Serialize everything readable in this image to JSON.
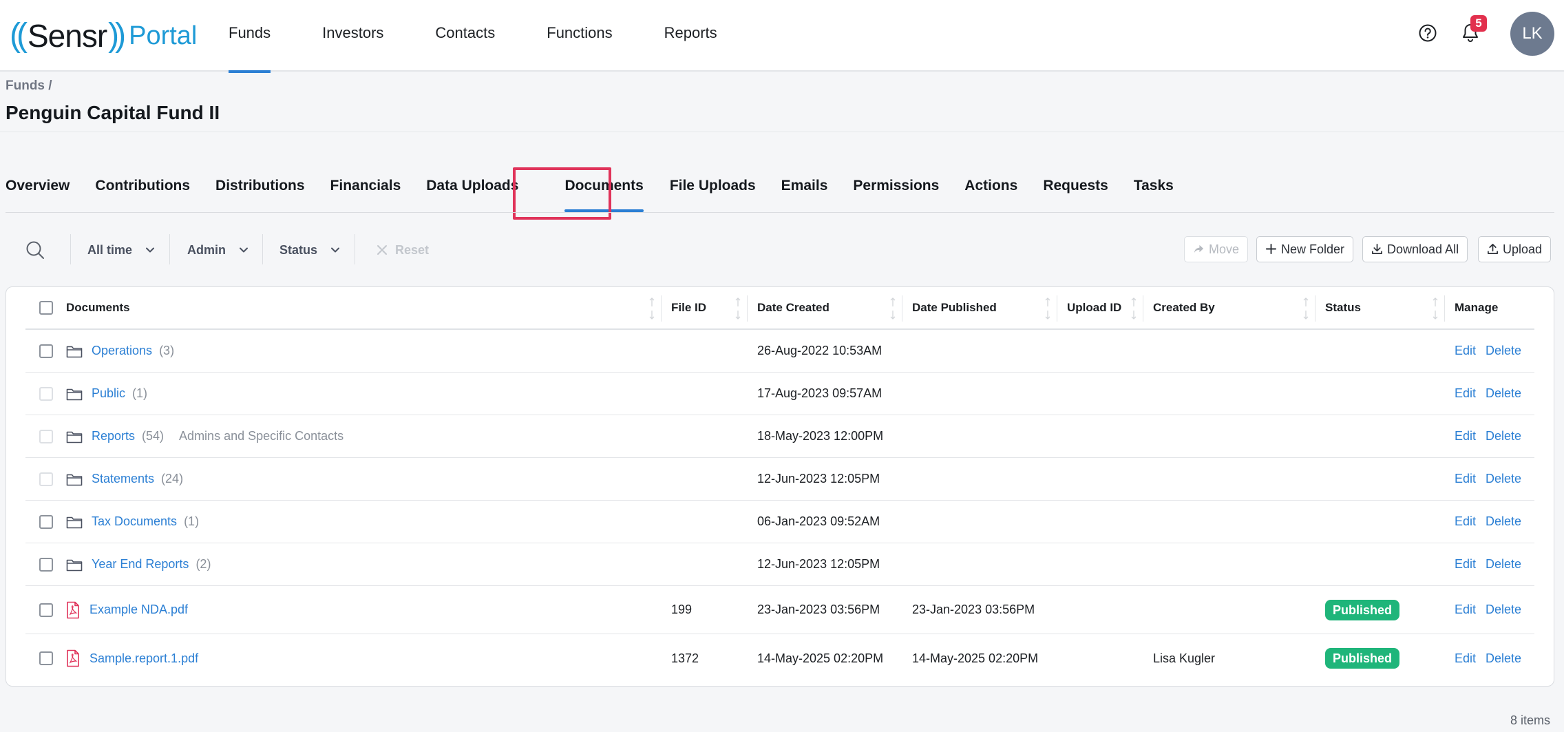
{
  "app": {
    "logo_paren_open": "((",
    "logo_sensr": "Sensr",
    "logo_paren_close": "))",
    "logo_portal": "Portal"
  },
  "nav": {
    "items": [
      {
        "label": "Funds",
        "active": true
      },
      {
        "label": "Investors"
      },
      {
        "label": "Contacts"
      },
      {
        "label": "Functions"
      },
      {
        "label": "Reports"
      }
    ],
    "notification_count": "5",
    "avatar_initials": "LK"
  },
  "breadcrumb": "Funds /",
  "page_title": "Penguin Capital Fund II",
  "tabs": [
    {
      "label": "Overview"
    },
    {
      "label": "Contributions"
    },
    {
      "label": "Distributions"
    },
    {
      "label": "Financials"
    },
    {
      "label": "Data Uploads"
    },
    {
      "label": "Documents",
      "active": true
    },
    {
      "label": "File Uploads"
    },
    {
      "label": "Emails"
    },
    {
      "label": "Permissions"
    },
    {
      "label": "Actions"
    },
    {
      "label": "Requests"
    },
    {
      "label": "Tasks"
    }
  ],
  "toolbar": {
    "filter_time": "All time",
    "filter_role": "Admin",
    "filter_status": "Status",
    "reset": "Reset",
    "move": "Move",
    "new_folder": "New Folder",
    "download_all": "Download All",
    "upload": "Upload"
  },
  "table": {
    "columns": {
      "documents": "Documents",
      "file_id": "File ID",
      "date_created": "Date Created",
      "date_published": "Date Published",
      "upload_id": "Upload ID",
      "created_by": "Created By",
      "status": "Status",
      "manage": "Manage"
    },
    "rows": [
      {
        "type": "folder",
        "name": "Operations",
        "count": "(3)",
        "access": "",
        "file_id": "",
        "date_created": "26-Aug-2022 10:53AM",
        "date_published": "",
        "upload_id": "",
        "created_by": "",
        "status": "",
        "edit": "Edit",
        "delete": "Delete"
      },
      {
        "type": "folder",
        "name": "Public",
        "count": "(1)",
        "access": "",
        "file_id": "",
        "date_created": "17-Aug-2023 09:57AM",
        "date_published": "",
        "upload_id": "",
        "created_by": "",
        "status": "",
        "edit": "Edit",
        "delete": "Delete"
      },
      {
        "type": "folder",
        "name": "Reports",
        "count": "(54)",
        "access": "Admins and Specific Contacts",
        "file_id": "",
        "date_created": "18-May-2023 12:00PM",
        "date_published": "",
        "upload_id": "",
        "created_by": "",
        "status": "",
        "edit": "Edit",
        "delete": "Delete"
      },
      {
        "type": "folder",
        "name": "Statements",
        "count": "(24)",
        "access": "",
        "file_id": "",
        "date_created": "12-Jun-2023 12:05PM",
        "date_published": "",
        "upload_id": "",
        "created_by": "",
        "status": "",
        "edit": "Edit",
        "delete": "Delete"
      },
      {
        "type": "folder",
        "name": "Tax Documents",
        "count": "(1)",
        "access": "",
        "file_id": "",
        "date_created": "06-Jan-2023 09:52AM",
        "date_published": "",
        "upload_id": "",
        "created_by": "",
        "status": "",
        "edit": "Edit",
        "delete": "Delete"
      },
      {
        "type": "folder",
        "name": "Year End Reports",
        "count": "(2)",
        "access": "",
        "file_id": "",
        "date_created": "12-Jun-2023 12:05PM",
        "date_published": "",
        "upload_id": "",
        "created_by": "",
        "status": "",
        "edit": "Edit",
        "delete": "Delete"
      },
      {
        "type": "pdf",
        "name": "Example NDA.pdf",
        "count": "",
        "access": "",
        "file_id": "199",
        "date_created": "23-Jan-2023 03:56PM",
        "date_published": "23-Jan-2023 03:56PM",
        "upload_id": "",
        "created_by": "",
        "status": "Published",
        "edit": "Edit",
        "delete": "Delete"
      },
      {
        "type": "pdf",
        "name": "Sample.report.1.pdf",
        "count": "",
        "access": "",
        "file_id": "1372",
        "date_created": "14-May-2025 02:20PM",
        "date_published": "14-May-2025 02:20PM",
        "upload_id": "",
        "created_by": "Lisa Kugler",
        "status": "Published",
        "edit": "Edit",
        "delete": "Delete"
      }
    ]
  },
  "footer": {
    "item_count": "8 items"
  },
  "colors": {
    "accent": "#2b7fd4",
    "brand": "#1e9ad6",
    "published": "#1fb57a",
    "highlight": "#e0335a",
    "badge": "#e2304d"
  },
  "icons": [
    "search-icon",
    "chevron-down-icon",
    "close-icon",
    "share-arrow-icon",
    "plus-icon",
    "download-icon",
    "upload-icon",
    "folder-icon",
    "pdf-icon",
    "help-icon",
    "bell-icon",
    "sort-icon"
  ]
}
